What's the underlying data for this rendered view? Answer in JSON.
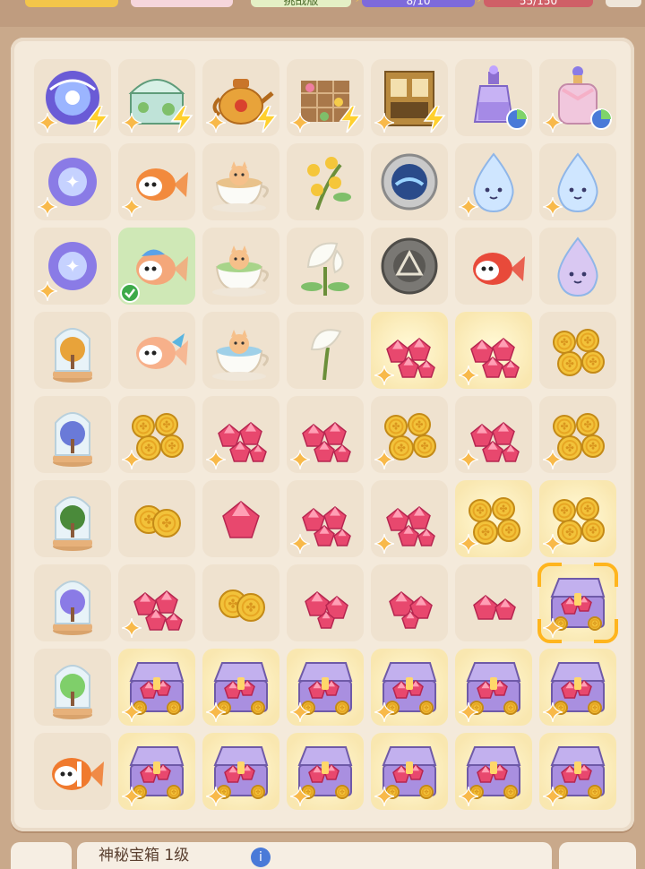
{
  "top_bar": {
    "task_label": "挑战版",
    "energy_a": "8/10",
    "energy_b": "55/150"
  },
  "bottom_bar": {
    "item_name": "神秘宝箱 1级",
    "info_glyph": "i"
  },
  "colors": {
    "board": "#f4eadb",
    "tile": "#efe2cf",
    "highlight": "#ffb51e",
    "selected": "#cfe8b6",
    "gem": "#e8486e",
    "coin": "#f2c23a",
    "chest": "#a98fe0"
  },
  "board": {
    "columns": 7,
    "rows": [
      [
        {
          "item": "galaxy-orb-icon",
          "spark": true,
          "bolt": true
        },
        {
          "item": "greenhouse-icon",
          "spark": true,
          "bolt": true
        },
        {
          "item": "golden-teapot-icon",
          "spark": true,
          "bolt": true
        },
        {
          "item": "flower-trellis-icon",
          "spark": true,
          "bolt": true
        },
        {
          "item": "tea-cabinet-icon",
          "spark": true,
          "bolt": true
        },
        {
          "item": "potion-bottle-icon",
          "spark": false,
          "pie": true
        },
        {
          "item": "perfume-bottle-icon",
          "spark": true,
          "pie": true
        }
      ],
      [
        {
          "item": "galaxy-orb-small-icon",
          "spark": true
        },
        {
          "item": "goldfish-icon",
          "spark": true
        },
        {
          "item": "cat-tea-cup-icon"
        },
        {
          "item": "osmanthus-flower-icon"
        },
        {
          "item": "water-wheel-icon"
        },
        {
          "item": "water-drop-icon",
          "spark": true
        },
        {
          "item": "water-drop-icon",
          "spark": true
        }
      ],
      [
        {
          "item": "galaxy-orb-small-icon",
          "spark": true
        },
        {
          "item": "betta-fish-icon",
          "selected": true,
          "check": true
        },
        {
          "item": "cat-green-tea-icon"
        },
        {
          "item": "calla-lily-icon"
        },
        {
          "item": "stone-seal-icon"
        },
        {
          "item": "red-fish-icon"
        },
        {
          "item": "water-drop-small-icon"
        }
      ],
      [
        {
          "item": "golden-tree-jar-icon"
        },
        {
          "item": "koi-fish-icon"
        },
        {
          "item": "cat-teacup-icon"
        },
        {
          "item": "calla-lily-small-icon"
        },
        {
          "item": "gem-pile-icon",
          "spark": true,
          "glow": true
        },
        {
          "item": "gem-pile-icon",
          "spark": true,
          "glow": true
        },
        {
          "item": "coin-pile-icon"
        }
      ],
      [
        {
          "item": "blue-tree-jar-icon"
        },
        {
          "item": "coin-pile-icon",
          "spark": true
        },
        {
          "item": "gem-pile-icon",
          "spark": true
        },
        {
          "item": "gem-pile-icon",
          "spark": true
        },
        {
          "item": "coin-pile-icon",
          "spark": true
        },
        {
          "item": "gem-pile-icon",
          "spark": true
        },
        {
          "item": "coin-pile-icon",
          "spark": true
        }
      ],
      [
        {
          "item": "bonsai-jar-icon"
        },
        {
          "item": "coin-pair-icon"
        },
        {
          "item": "gem-icon"
        },
        {
          "item": "gem-pile-icon",
          "spark": true
        },
        {
          "item": "gem-pile-icon",
          "spark": true
        },
        {
          "item": "coin-pile-icon",
          "spark": true,
          "glow": true
        },
        {
          "item": "coin-pile-icon",
          "spark": true,
          "glow": true
        }
      ],
      [
        {
          "item": "lavender-jar-icon"
        },
        {
          "item": "gem-pile-icon",
          "spark": true
        },
        {
          "item": "coin-pair-icon"
        },
        {
          "item": "gem-cluster-icon"
        },
        {
          "item": "gem-cluster-icon"
        },
        {
          "item": "gem-pair-icon"
        },
        {
          "item": "treasure-chest-icon",
          "spark": true,
          "highlight": true,
          "glow": true
        }
      ],
      [
        {
          "item": "green-plant-jar-icon"
        },
        {
          "item": "treasure-chest-icon",
          "spark": true,
          "glow": true
        },
        {
          "item": "treasure-chest-icon",
          "spark": true,
          "glow": true
        },
        {
          "item": "treasure-chest-icon",
          "spark": true,
          "glow": true
        },
        {
          "item": "treasure-chest-icon",
          "spark": true,
          "glow": true
        },
        {
          "item": "treasure-chest-icon",
          "spark": true,
          "glow": true
        },
        {
          "item": "treasure-chest-icon",
          "spark": true,
          "glow": true
        }
      ],
      [
        {
          "item": "clownfish-icon"
        },
        {
          "item": "treasure-chest-icon",
          "spark": true,
          "glow": true
        },
        {
          "item": "treasure-chest-icon",
          "spark": true,
          "glow": true
        },
        {
          "item": "treasure-chest-icon",
          "spark": true,
          "glow": true
        },
        {
          "item": "treasure-chest-icon",
          "spark": true,
          "glow": true
        },
        {
          "item": "treasure-chest-icon",
          "spark": true,
          "glow": true
        },
        {
          "item": "treasure-chest-icon",
          "spark": true,
          "glow": true
        }
      ]
    ]
  }
}
